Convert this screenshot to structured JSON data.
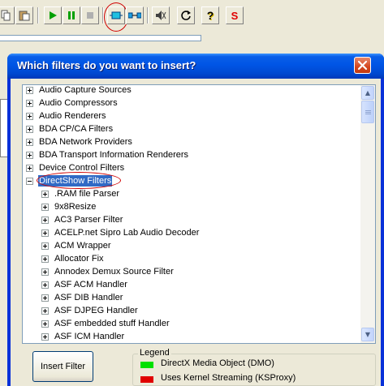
{
  "toolbar": {
    "buttons": [
      {
        "icon": "copy-icon"
      },
      {
        "icon": "paste-icon"
      },
      {
        "icon": "play-icon"
      },
      {
        "icon": "pause-icon"
      },
      {
        "icon": "stop-icon"
      },
      {
        "icon": "insert-filter-icon"
      },
      {
        "icon": "connect-pins-icon"
      },
      {
        "icon": "mute-icon"
      },
      {
        "icon": "refresh-icon"
      },
      {
        "icon": "help-icon"
      },
      {
        "icon": "stop-s-icon",
        "glyph": "S"
      }
    ],
    "help_glyph": "?"
  },
  "dialog": {
    "title": "Which filters do you want to insert?",
    "close_glyph": "✕"
  },
  "tree": {
    "rows": [
      {
        "label": "Audio Capture Sources",
        "expander": "+",
        "level": 0
      },
      {
        "label": "Audio Compressors",
        "expander": "+",
        "level": 0
      },
      {
        "label": "Audio Renderers",
        "expander": "+",
        "level": 0
      },
      {
        "label": "BDA CP/CA Filters",
        "expander": "+",
        "level": 0
      },
      {
        "label": "BDA Network Providers",
        "expander": "+",
        "level": 0
      },
      {
        "label": "BDA Transport Information Renderers",
        "expander": "+",
        "level": 0
      },
      {
        "label": "Device Control Filters",
        "expander": "+",
        "level": 0
      },
      {
        "label": "DirectShow Filters",
        "expander": "-",
        "level": 0,
        "selected": true
      },
      {
        "label": ".RAM file Parser",
        "expander": "+",
        "level": 1
      },
      {
        "label": "9x8Resize",
        "expander": "+",
        "level": 1
      },
      {
        "label": "AC3 Parser Filter",
        "expander": "+",
        "level": 1
      },
      {
        "label": "ACELP.net Sipro Lab Audio Decoder",
        "expander": "+",
        "level": 1
      },
      {
        "label": "ACM Wrapper",
        "expander": "+",
        "level": 1
      },
      {
        "label": "Allocator Fix",
        "expander": "+",
        "level": 1
      },
      {
        "label": "Annodex Demux Source Filter",
        "expander": "+",
        "level": 1
      },
      {
        "label": "ASF ACM Handler",
        "expander": "+",
        "level": 1
      },
      {
        "label": "ASF DIB Handler",
        "expander": "+",
        "level": 1
      },
      {
        "label": "ASF DJPEG Handler",
        "expander": "+",
        "level": 1
      },
      {
        "label": "ASF embedded stuff Handler",
        "expander": "+",
        "level": 1
      },
      {
        "label": "ASF ICM Handler",
        "expander": "+",
        "level": 1
      }
    ],
    "scroll_up": "▲",
    "scroll_down": "▼"
  },
  "insert_button": {
    "label": "Insert Filter"
  },
  "legend": {
    "title": "Legend",
    "items": [
      {
        "label": "DirectX Media Object (DMO)",
        "color": "#00e000"
      },
      {
        "label": "Uses Kernel Streaming (KSProxy)",
        "color": "#e00000"
      }
    ]
  }
}
